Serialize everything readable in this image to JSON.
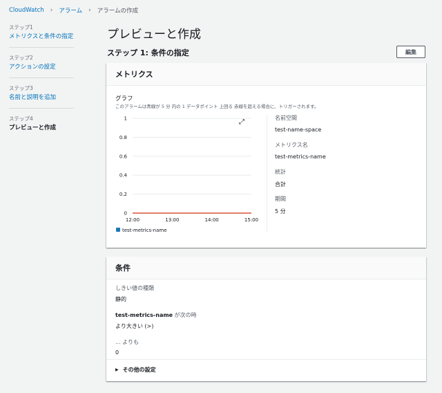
{
  "breadcrumb": {
    "home": "CloudWatch",
    "alarms": "アラーム",
    "current": "アラームの作成"
  },
  "steps": [
    {
      "num": "ステップ1",
      "name": "メトリクスと条件の指定"
    },
    {
      "num": "ステップ2",
      "name": "アクションの設定"
    },
    {
      "num": "ステップ3",
      "name": "名前と説明を追加"
    },
    {
      "num": "ステップ4",
      "name": "プレビューと作成"
    }
  ],
  "page_title": "プレビューと作成",
  "step1_title": "ステップ 1: 条件の指定",
  "edit_label": "編集",
  "metrics_panel": {
    "title": "メトリクス",
    "graph_label": "グラフ",
    "graph_desc": "このアラームは青線が 5 分 内の 1 データポイント 上回る 赤線を超える場合に、トリガーされます。",
    "details": [
      {
        "key": "名前空間",
        "value": "test-name-space"
      },
      {
        "key": "メトリクス名",
        "value": "test-metrics-name"
      },
      {
        "key": "統計",
        "value": "合計"
      },
      {
        "key": "期間",
        "value": "5 分"
      }
    ]
  },
  "conditions_panel": {
    "title": "条件",
    "threshold_type_label": "しきい値の種類",
    "threshold_type_value": "静的",
    "metric_name": "test-metrics-name",
    "when_suffix": " が次の時",
    "comparison_value": "より大きい (>)",
    "than_label": "... よりも",
    "than_value": "0",
    "more_settings": "その他の設定"
  },
  "colors": {
    "link": "#0073bb",
    "threshold_line": "#d13212",
    "series": "#1f77b4"
  },
  "chart_data": {
    "type": "line",
    "x": [
      "12:00",
      "13:00",
      "14:00",
      "15:00"
    ],
    "ylim": [
      0,
      1
    ],
    "yticks": [
      "1",
      "0.8",
      "0.6",
      "0.4",
      "0.2",
      "0"
    ],
    "series": [
      {
        "name": "test-metrics-name",
        "values": []
      }
    ],
    "threshold": 0,
    "grid": true,
    "legend": "bottom-left"
  }
}
